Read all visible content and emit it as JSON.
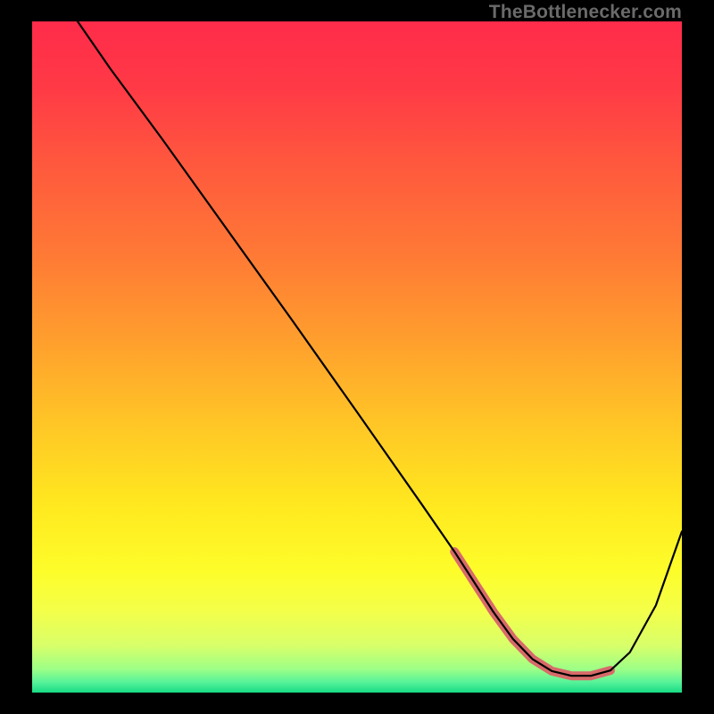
{
  "watermark": "TheBottlenecker.com",
  "gradient": {
    "stops": [
      {
        "offset": 0.0,
        "color": "#ff2b4a"
      },
      {
        "offset": 0.1,
        "color": "#ff3a46"
      },
      {
        "offset": 0.22,
        "color": "#ff5a3d"
      },
      {
        "offset": 0.35,
        "color": "#ff7a35"
      },
      {
        "offset": 0.48,
        "color": "#ffa02d"
      },
      {
        "offset": 0.6,
        "color": "#ffc626"
      },
      {
        "offset": 0.72,
        "color": "#ffe81f"
      },
      {
        "offset": 0.82,
        "color": "#fdfd2a"
      },
      {
        "offset": 0.88,
        "color": "#f3ff4a"
      },
      {
        "offset": 0.93,
        "color": "#d8ff6a"
      },
      {
        "offset": 0.965,
        "color": "#9dff86"
      },
      {
        "offset": 0.985,
        "color": "#55f29a"
      },
      {
        "offset": 1.0,
        "color": "#18db84"
      }
    ]
  },
  "chart_data": {
    "type": "line",
    "title": "",
    "xlabel": "",
    "ylabel": "",
    "xlim": [
      0,
      100
    ],
    "ylim": [
      0,
      100
    ],
    "series": [
      {
        "name": "curve",
        "x": [
          7,
          12,
          20,
          30,
          40,
          50,
          60,
          65,
          68,
          71,
          74,
          77,
          80,
          83,
          86,
          89,
          92,
          96,
          100
        ],
        "y": [
          100,
          93,
          82.5,
          69,
          55.5,
          41.8,
          28,
          21,
          16.5,
          12,
          8,
          5,
          3.2,
          2.5,
          2.5,
          3.3,
          6,
          13,
          24
        ]
      },
      {
        "name": "highlight",
        "x": [
          65,
          68,
          71,
          74,
          77,
          80,
          83,
          86,
          89
        ],
        "y": [
          21,
          16.5,
          12,
          8,
          5,
          3.2,
          2.5,
          2.5,
          3.3
        ]
      }
    ],
    "styles": {
      "curve": {
        "stroke": "#000000",
        "width": 2.2,
        "fill": "none"
      },
      "highlight": {
        "stroke": "#d86a6a",
        "width": 10,
        "fill": "none",
        "linecap": "round",
        "linejoin": "round"
      }
    }
  }
}
